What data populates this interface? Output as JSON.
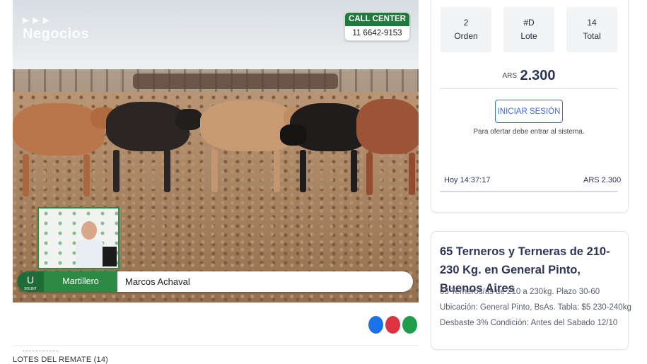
{
  "video": {
    "watermark": "Negocios",
    "call_center": {
      "title": "CALL CENTER",
      "phone": "11 6642-9153"
    },
    "lower_third": {
      "logo_text": "U",
      "logo_sub": "SOLBIT",
      "role": "Martillero",
      "name": "Marcos Achaval"
    }
  },
  "social_colors": {
    "share_blue": "#1a73e8",
    "share_red": "#db3340",
    "share_green": "#1f9d4c"
  },
  "lotes_header": "LOTES DEL REMATE (14)",
  "bid_panel": {
    "stats": [
      {
        "value": "2",
        "label": "Orden"
      },
      {
        "value": "#D",
        "label": "Lote"
      },
      {
        "value": "14",
        "label": "Total"
      }
    ],
    "price_currency": "ARS",
    "price_amount": "2.300",
    "login_button": "INICIAR SESIÓN",
    "login_note": "Para ofertar debe entrar al sistema.",
    "history": [
      {
        "time": "Hoy 14:37:17",
        "amount": "ARS 2.300"
      }
    ]
  },
  "lot": {
    "title": "65 Terneros y Terneras de 210-230 Kg. en General Pinto, Buenos Aires",
    "details": [
      "65 Terneros/as de 210 a 230kg. Plazo 30-60",
      "Ubicación: General Pinto, BsAs. Tabla: $5 230-240kg",
      "Desbaste 3% Condición: Antes del Sabado 12/10"
    ]
  },
  "colors": {
    "accent_green": "#2c8a45",
    "accent_blue": "#3c6ed8",
    "text_navy": "#2e3557"
  }
}
